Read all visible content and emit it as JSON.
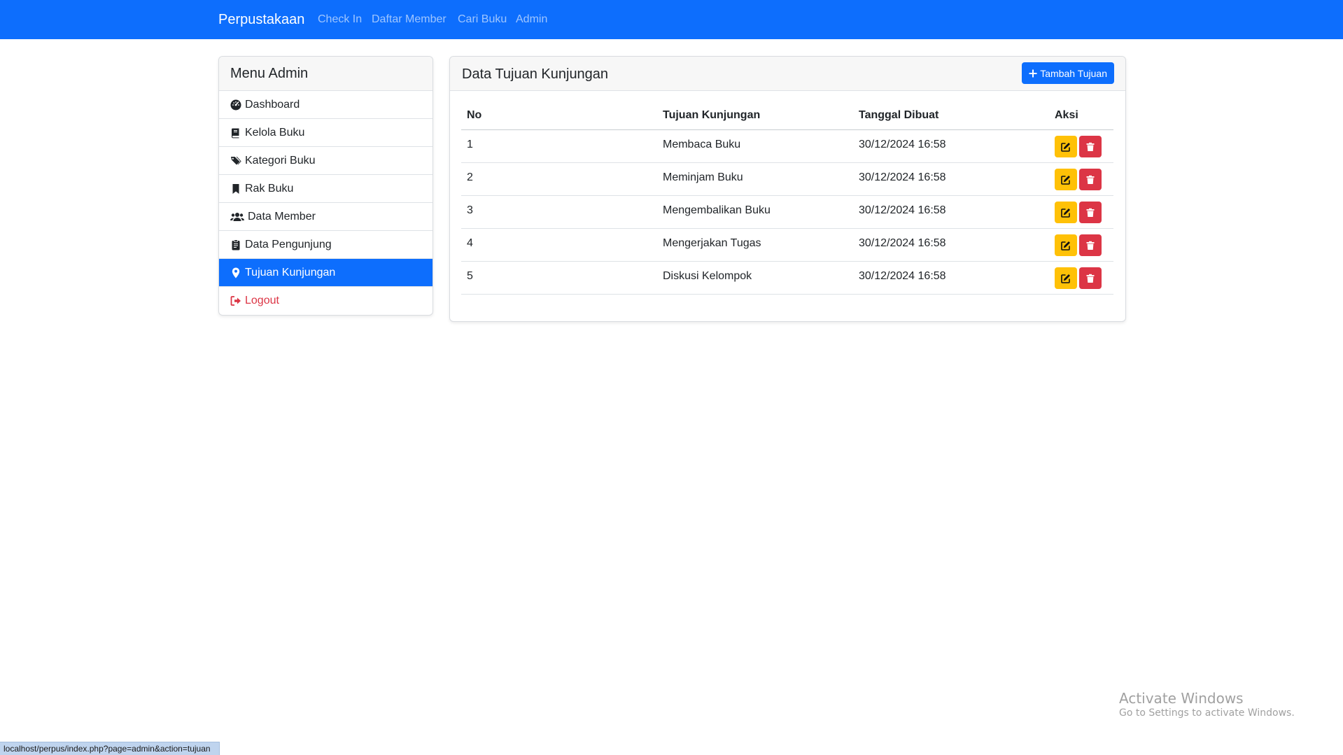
{
  "navbar": {
    "brand": "Perpustakaan",
    "links": [
      "Check In",
      "Daftar Member",
      "Cari Buku",
      "Admin"
    ]
  },
  "sidebar": {
    "title": "Menu Admin",
    "items": [
      {
        "label": "Dashboard",
        "icon": "dashboard-icon"
      },
      {
        "label": "Kelola Buku",
        "icon": "book-icon"
      },
      {
        "label": "Kategori Buku",
        "icon": "tags-icon"
      },
      {
        "label": "Rak Buku",
        "icon": "bookmark-icon"
      },
      {
        "label": "Data Member",
        "icon": "users-icon"
      },
      {
        "label": "Data Pengunjung",
        "icon": "clipboard-icon"
      },
      {
        "label": "Tujuan Kunjungan",
        "icon": "map-marker-icon",
        "active": true
      },
      {
        "label": "Logout",
        "icon": "sign-out-icon"
      }
    ]
  },
  "main": {
    "title": "Data Tujuan Kunjungan",
    "add_button_label": "Tambah Tujuan",
    "columns": [
      "No",
      "Tujuan Kunjungan",
      "Tanggal Dibuat",
      "Aksi"
    ],
    "rows": [
      {
        "no": "1",
        "tujuan": "Membaca Buku",
        "tanggal": "30/12/2024 16:58"
      },
      {
        "no": "2",
        "tujuan": "Meminjam Buku",
        "tanggal": "30/12/2024 16:58"
      },
      {
        "no": "3",
        "tujuan": "Mengembalikan Buku",
        "tanggal": "30/12/2024 16:58"
      },
      {
        "no": "4",
        "tujuan": "Mengerjakan Tugas",
        "tanggal": "30/12/2024 16:58"
      },
      {
        "no": "5",
        "tujuan": "Diskusi Kelompok",
        "tanggal": "30/12/2024 16:58"
      }
    ]
  },
  "statusbar": {
    "url": "localhost/perpus/index.php?page=admin&action=tujuan"
  },
  "watermark": {
    "title": "Activate Windows",
    "subtitle": "Go to Settings to activate Windows."
  },
  "colors": {
    "primary": "#0d6efd",
    "warning": "#ffc107",
    "danger": "#dc3545"
  }
}
